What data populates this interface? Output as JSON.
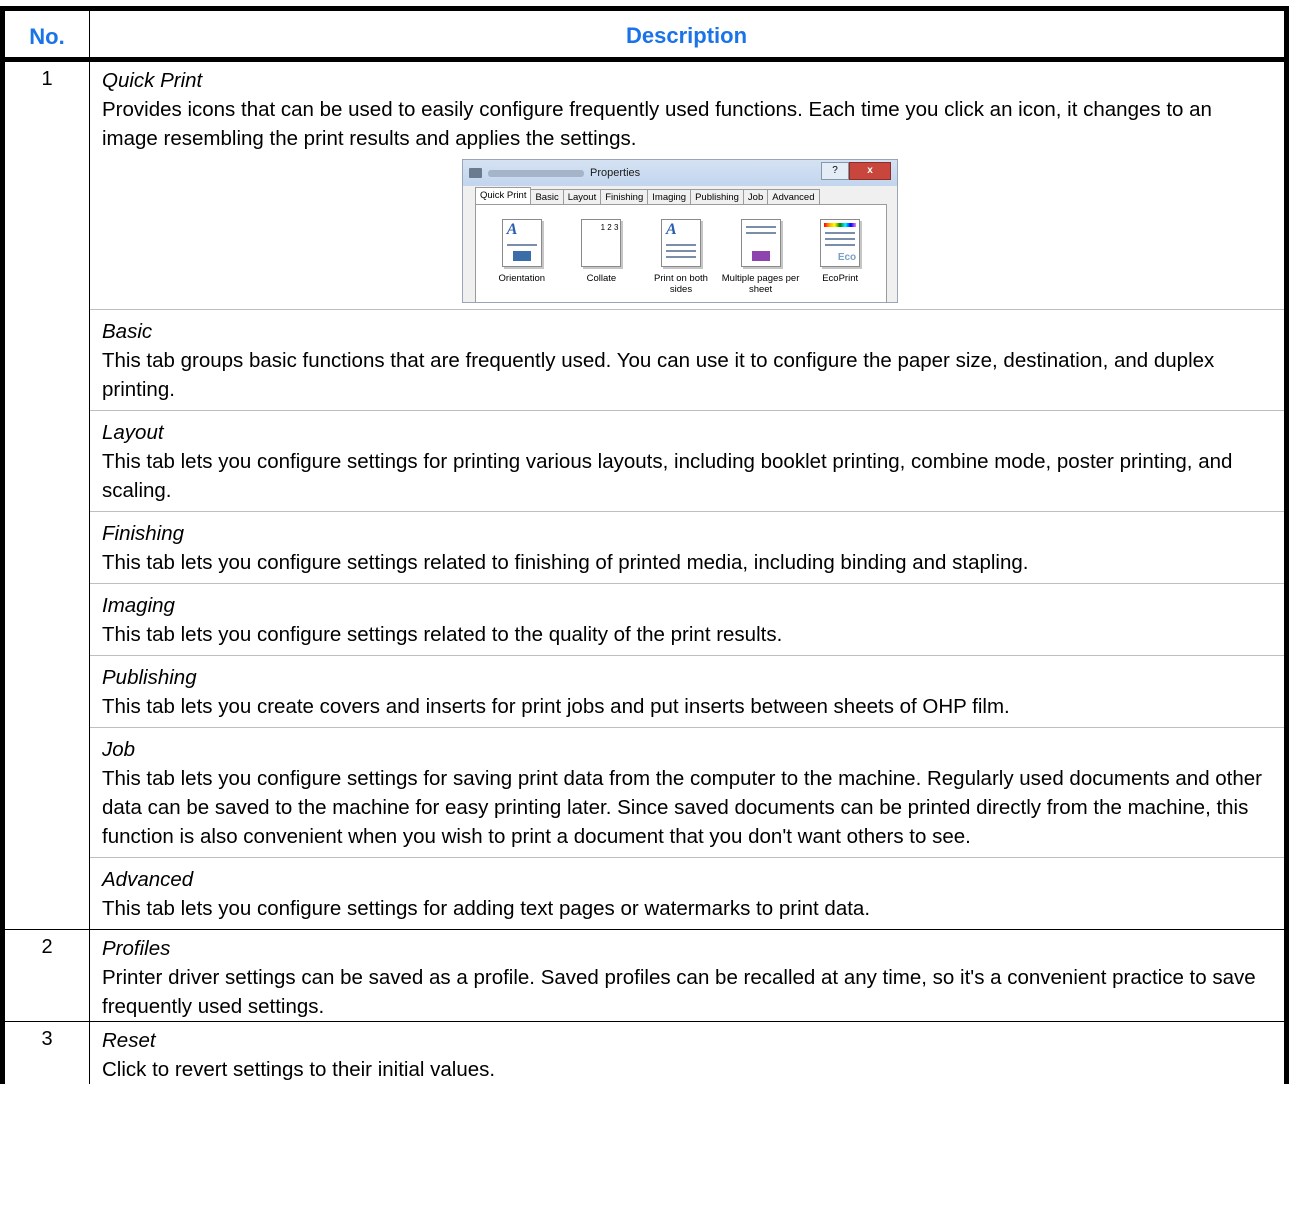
{
  "table": {
    "header": {
      "no": "No.",
      "description": "Description"
    },
    "rows": [
      {
        "no": "1",
        "entries": [
          {
            "title": "Quick Print",
            "text": "Provides icons that can be used to easily configure frequently used functions. Each time you click an icon, it changes to an image resembling the print results and applies the settings."
          },
          {
            "title": "Basic",
            "text": "This tab groups basic functions that are frequently used. You can use it to configure the paper size, destination, and duplex printing."
          },
          {
            "title": "Layout",
            "text": "This tab lets you configure settings for printing various layouts, including booklet printing, combine mode, poster printing, and scaling."
          },
          {
            "title": "Finishing",
            "text": "This tab lets you configure settings related to finishing of printed media, including binding and stapling."
          },
          {
            "title": "Imaging",
            "text": "This tab lets you configure settings related to the quality of the print results."
          },
          {
            "title": "Publishing",
            "text": "This tab lets you create covers and inserts for print jobs and put inserts between sheets of OHP film."
          },
          {
            "title": "Job",
            "text": "This tab lets you configure settings for saving print data from the computer to the machine. Regularly used documents and other data can be saved to the machine for easy printing later. Since saved documents can be printed directly from the machine, this function is also convenient when you wish to print a document that you don't want others to see."
          },
          {
            "title": "Advanced",
            "text": "This tab lets you configure settings for adding text pages or watermarks to print data."
          }
        ]
      },
      {
        "no": "2",
        "entries": [
          {
            "title": "Profiles",
            "text": "Printer driver settings can be saved as a profile. Saved profiles can be recalled at any time, so it's a convenient practice to save frequently used settings."
          }
        ]
      },
      {
        "no": "3",
        "entries": [
          {
            "title": "Reset",
            "text": "Click to revert settings to their initial values."
          }
        ]
      }
    ]
  },
  "dialog": {
    "title": "Properties",
    "help": "?",
    "close": "x",
    "tabs": [
      "Quick Print",
      "Basic",
      "Layout",
      "Finishing",
      "Imaging",
      "Publishing",
      "Job",
      "Advanced"
    ],
    "icons": [
      {
        "label": "Orientation",
        "icon": "orientation-icon"
      },
      {
        "label": "Collate",
        "icon": "collate-icon",
        "glyph": "1 2 3"
      },
      {
        "label": "Print on both sides",
        "icon": "duplex-icon"
      },
      {
        "label": "Multiple pages per sheet",
        "icon": "multiple-pages-icon"
      },
      {
        "label": "EcoPrint",
        "icon": "ecoprint-icon",
        "glyph": "Eco"
      }
    ]
  }
}
